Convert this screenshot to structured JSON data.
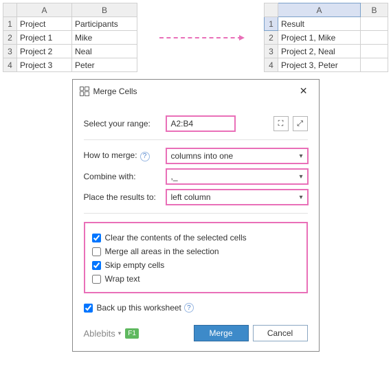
{
  "left_table": {
    "cols": [
      "A",
      "B"
    ],
    "rows": [
      {
        "n": "1",
        "a": "Project",
        "b": "Participants",
        "bold": true
      },
      {
        "n": "2",
        "a": "Project 1",
        "b": "Mike"
      },
      {
        "n": "3",
        "a": "Project 2",
        "b": "Neal"
      },
      {
        "n": "4",
        "a": "Project 3",
        "b": "Peter"
      }
    ]
  },
  "right_table": {
    "cols": [
      "A",
      "B"
    ],
    "rows": [
      {
        "n": "1",
        "a": "Result",
        "b": "",
        "bold": true
      },
      {
        "n": "2",
        "a": "Project 1, Mike",
        "b": ""
      },
      {
        "n": "3",
        "a": "Project 2, Neal",
        "b": ""
      },
      {
        "n": "4",
        "a": "Project 3, Peter",
        "b": ""
      }
    ]
  },
  "dialog": {
    "title": "Merge Cells",
    "range_label": "Select your range:",
    "range_value": "A2:B4",
    "how_label": "How to merge:",
    "how_value": "columns into one",
    "combine_label": "Combine with:",
    "combine_value": ",_",
    "place_label": "Place the results to:",
    "place_value": "left column",
    "chk_clear": "Clear the contents of the selected cells",
    "chk_merge_areas": "Merge all areas in the selection",
    "chk_skip": "Skip empty cells",
    "chk_wrap": "Wrap text",
    "chk_backup": "Back up this worksheet",
    "brand": "Ablebits",
    "f1": "F1",
    "merge_btn": "Merge",
    "cancel_btn": "Cancel"
  }
}
